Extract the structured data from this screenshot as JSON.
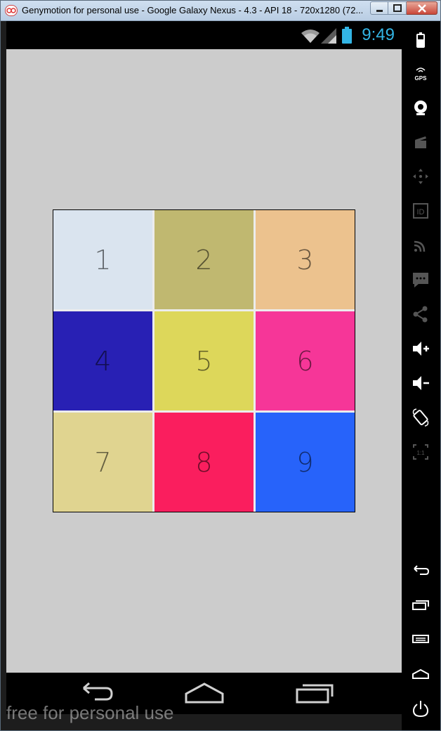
{
  "window": {
    "title": "Genymotion for personal use - Google Galaxy Nexus - 4.3 - API 18 - 720x1280 (72..."
  },
  "statusbar": {
    "time": "9:49"
  },
  "grid": {
    "cells": [
      {
        "label": "1",
        "color": "#dae4ef"
      },
      {
        "label": "2",
        "color": "#c0b870"
      },
      {
        "label": "3",
        "color": "#ecc28e"
      },
      {
        "label": "4",
        "color": "#2820b4"
      },
      {
        "label": "5",
        "color": "#ddd75a"
      },
      {
        "label": "6",
        "color": "#f63698"
      },
      {
        "label": "7",
        "color": "#e0d490"
      },
      {
        "label": "8",
        "color": "#fa1e5e"
      },
      {
        "label": "9",
        "color": "#2763fa"
      }
    ]
  },
  "sidebar": {
    "gps_label": "GPS",
    "id_label": "ID",
    "scale_label": "1:1"
  },
  "watermark": "free for personal use",
  "colors": {
    "accent": "#33b5e5",
    "screen_bg": "#cccccc"
  }
}
